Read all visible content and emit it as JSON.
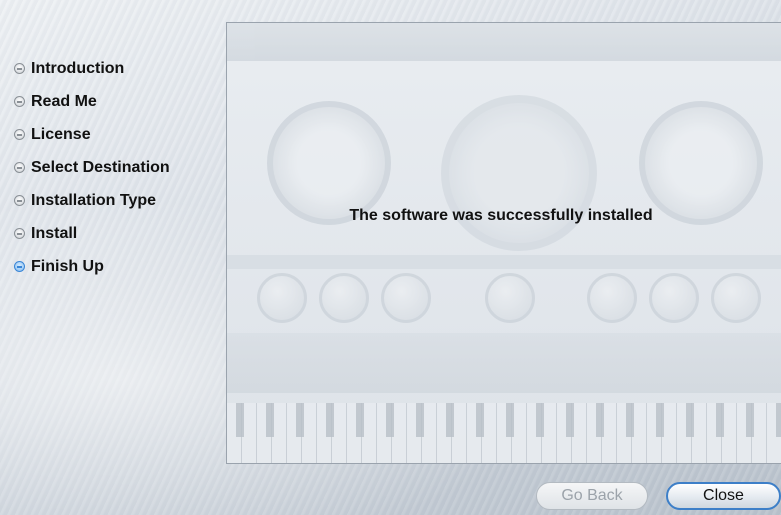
{
  "steps": [
    {
      "label": "Introduction",
      "current": false
    },
    {
      "label": "Read Me",
      "current": false
    },
    {
      "label": "License",
      "current": false
    },
    {
      "label": "Select Destination",
      "current": false
    },
    {
      "label": "Installation Type",
      "current": false
    },
    {
      "label": "Install",
      "current": false
    },
    {
      "label": "Finish Up",
      "current": true
    }
  ],
  "content": {
    "message": "The software was successfully installed"
  },
  "buttons": {
    "back_label": "Go Back",
    "back_enabled": false,
    "close_label": "Close"
  },
  "colors": {
    "accent": "#3a86d6"
  }
}
